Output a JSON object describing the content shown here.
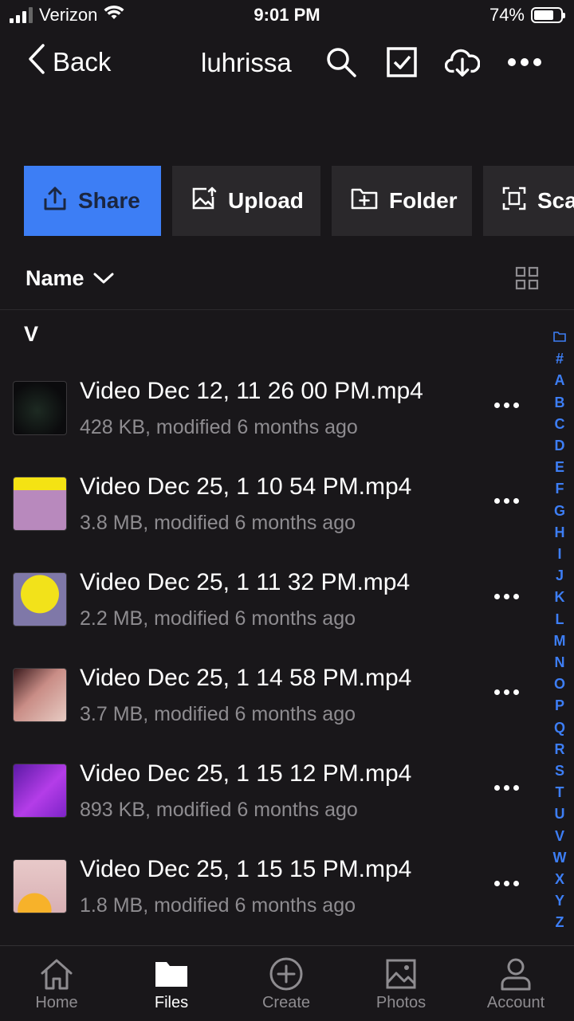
{
  "status_bar": {
    "carrier": "Verizon",
    "time": "9:01 PM",
    "battery": "74%",
    "battery_level": 0.74
  },
  "nav": {
    "back_label": "Back",
    "title": "luhrissa"
  },
  "actions": [
    {
      "label": "Share",
      "icon": "share-icon"
    },
    {
      "label": "Upload",
      "icon": "upload-image-icon"
    },
    {
      "label": "Folder",
      "icon": "new-folder-icon"
    },
    {
      "label": "Sca",
      "icon": "scan-icon"
    }
  ],
  "sort": {
    "label": "Name"
  },
  "section_header": "V",
  "files": [
    {
      "name": "Video Dec 12, 11 26 00 PM.mp4",
      "meta": "428 KB, modified 6 months ago"
    },
    {
      "name": "Video Dec 25, 1 10 54 PM.mp4",
      "meta": "3.8 MB, modified 6 months ago"
    },
    {
      "name": "Video Dec 25, 1 11 32 PM.mp4",
      "meta": "2.2 MB, modified 6 months ago"
    },
    {
      "name": "Video Dec 25, 1 14 58 PM.mp4",
      "meta": "3.7 MB, modified 6 months ago"
    },
    {
      "name": "Video Dec 25, 1 15 12 PM.mp4",
      "meta": "893 KB, modified 6 months ago"
    },
    {
      "name": "Video Dec 25, 1 15 15 PM.mp4",
      "meta": "1.8 MB, modified 6 months ago"
    }
  ],
  "alpha_index": [
    "#",
    "A",
    "B",
    "C",
    "D",
    "E",
    "F",
    "G",
    "H",
    "I",
    "J",
    "K",
    "L",
    "M",
    "N",
    "O",
    "P",
    "Q",
    "R",
    "S",
    "T",
    "U",
    "V",
    "W",
    "X",
    "Y",
    "Z"
  ],
  "tabs": [
    {
      "label": "Home",
      "icon": "home-icon"
    },
    {
      "label": "Files",
      "icon": "folder-icon"
    },
    {
      "label": "Create",
      "icon": "plus-circle-icon"
    },
    {
      "label": "Photos",
      "icon": "photos-icon"
    },
    {
      "label": "Account",
      "icon": "account-icon"
    }
  ],
  "colors": {
    "accent": "#3d7ef5",
    "background": "#19171a",
    "button": "#2a282b",
    "muted_text": "#8e8c90"
  }
}
